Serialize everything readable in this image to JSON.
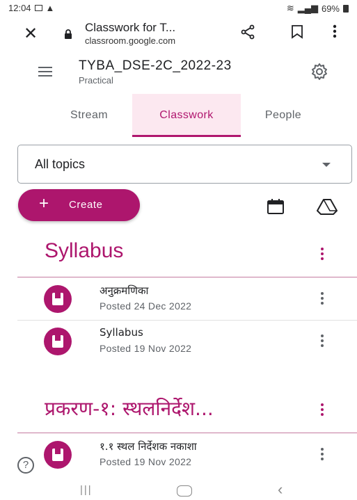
{
  "status_bar": {
    "time": "12:04",
    "battery": "69%"
  },
  "browser": {
    "title": "Classwork for T...",
    "host": "classroom.google.com"
  },
  "class": {
    "name": "TYBA_DSE-2C_2022-23",
    "section": "Practical"
  },
  "tabs": [
    {
      "label": "Stream"
    },
    {
      "label": "Classwork",
      "active": true
    },
    {
      "label": "People"
    }
  ],
  "filter": {
    "selected": "All topics"
  },
  "create_label": "Create",
  "sections": [
    {
      "title": "Syllabus",
      "items": [
        {
          "name": "अनुक्रमणिका",
          "posted": "Posted 24 Dec 2022"
        },
        {
          "name": "Syllabus",
          "posted": "Posted 19 Nov 2022"
        }
      ]
    },
    {
      "title": "प्रकरण-१: स्थलनिर्देश...",
      "items": [
        {
          "name": "१.१ स्थल निर्देशक नकाशा",
          "posted": "Posted 19 Nov 2022"
        }
      ]
    }
  ],
  "help_label": "?",
  "colors": {
    "accent": "#ad166d",
    "tab_bg": "#fce8f0"
  }
}
